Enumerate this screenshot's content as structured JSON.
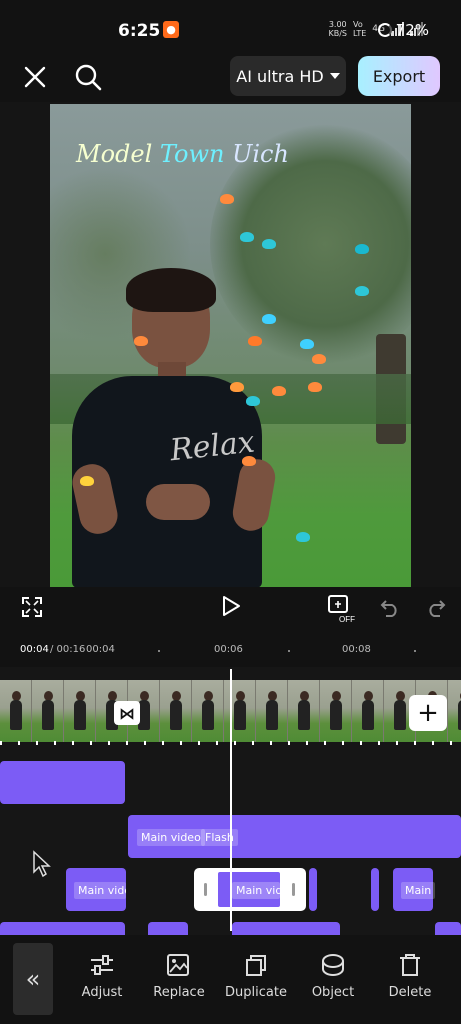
{
  "status_bar": {
    "time": "6:25",
    "speed_value": "3.00",
    "speed_unit": "KB/S",
    "network_top": "Vo",
    "network_bottom": "LTE",
    "network_gen": "4G",
    "battery": "72%"
  },
  "toolbar": {
    "quality_label": "AI ultra HD",
    "export_label": "Export"
  },
  "preview": {
    "caption_words": [
      "Model",
      "Town",
      "Uich"
    ],
    "shirt_text": "Relax"
  },
  "ruler": {
    "current_time": "00:04",
    "total_time": "/ 00:16",
    "ticks": [
      "00:04",
      "00:06",
      "00:08"
    ]
  },
  "timeline": {
    "labels": {
      "main_video_1": "Main video",
      "flash": "Flash",
      "main_video_2": "Main video",
      "main_video_3": "Main video",
      "main_video_4": "Main"
    }
  },
  "bottom_toolbar": {
    "tools": [
      "Adjust",
      "Replace",
      "Duplicate",
      "Object",
      "Delete"
    ]
  },
  "colors": {
    "accent_track": "#7c5cf5",
    "export_gradient_start": "#a8f0ff",
    "export_gradient_end": "#e0c8ff",
    "background": "#121212"
  }
}
